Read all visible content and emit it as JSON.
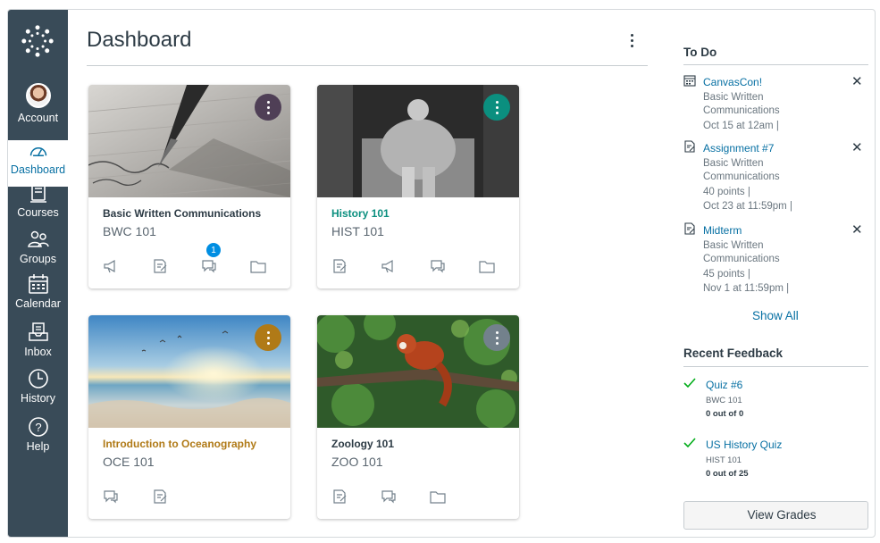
{
  "nav": {
    "logo_icon": "canvas-logo-icon",
    "items": [
      {
        "label": "Account",
        "icon": "avatar"
      },
      {
        "label": "Dashboard",
        "icon": "dashboard-icon"
      },
      {
        "label": "Courses",
        "icon": "courses-icon"
      },
      {
        "label": "Groups",
        "icon": "groups-icon"
      },
      {
        "label": "Calendar",
        "icon": "calendar-icon"
      },
      {
        "label": "Inbox",
        "icon": "inbox-icon"
      },
      {
        "label": "History",
        "icon": "history-icon"
      },
      {
        "label": "Help",
        "icon": "help-icon"
      }
    ],
    "active": "Dashboard",
    "colors": {
      "background": "#394b58",
      "active_text": "#0770a3"
    }
  },
  "header": {
    "title": "Dashboard"
  },
  "cards": [
    {
      "name": "Basic Written Communications",
      "code": "BWC 101",
      "color": "#4f3f56",
      "name_color": "#2d3b45",
      "icons": [
        "announcements-icon",
        "assignments-icon",
        "discussions-icon",
        "files-icon"
      ],
      "badge": "1"
    },
    {
      "name": "History 101",
      "code": "HIST 101",
      "color": "#0b8f7f",
      "name_color": "#0b8f7f",
      "icons": [
        "assignments-icon",
        "announcements-icon",
        "discussions-icon",
        "files-icon"
      ]
    },
    {
      "name": "Introduction to Oceanography",
      "code": "OCE 101",
      "color": "#b07a17",
      "name_color": "#b07a17",
      "icons": [
        "discussions-icon",
        "assignments-icon"
      ]
    },
    {
      "name": "Zoology 101",
      "code": "ZOO 101",
      "color": "#73818c",
      "name_color": "#2d3b45",
      "icons": [
        "assignments-icon",
        "discussions-icon",
        "files-icon"
      ]
    }
  ],
  "todo": {
    "heading": "To Do",
    "items": [
      {
        "title": "CanvasCon!",
        "icon": "calendar-event-icon",
        "course": [
          "Basic Written",
          "Communications"
        ],
        "meta": [
          "Oct 15 at 12am  |"
        ]
      },
      {
        "title": "Assignment #7",
        "icon": "assignment-icon",
        "course": [
          "Basic Written",
          "Communications"
        ],
        "meta": [
          "40 points  |",
          "Oct 23 at 11:59pm  |"
        ]
      },
      {
        "title": "Midterm",
        "icon": "assignment-icon",
        "course": [
          "Basic Written",
          "Communications"
        ],
        "meta": [
          "45 points  |",
          "Nov 1 at 11:59pm  |"
        ]
      }
    ],
    "dismiss": "✕",
    "show_all": "Show All"
  },
  "feedback": {
    "heading": "Recent Feedback",
    "items": [
      {
        "title": "Quiz #6",
        "code": "BWC 101",
        "score": "0 out of 0"
      },
      {
        "title": "US History Quiz",
        "code": "HIST 101",
        "score": "0 out of 25"
      }
    ],
    "check_color": "#00ac18"
  },
  "view_grades": "View Grades"
}
